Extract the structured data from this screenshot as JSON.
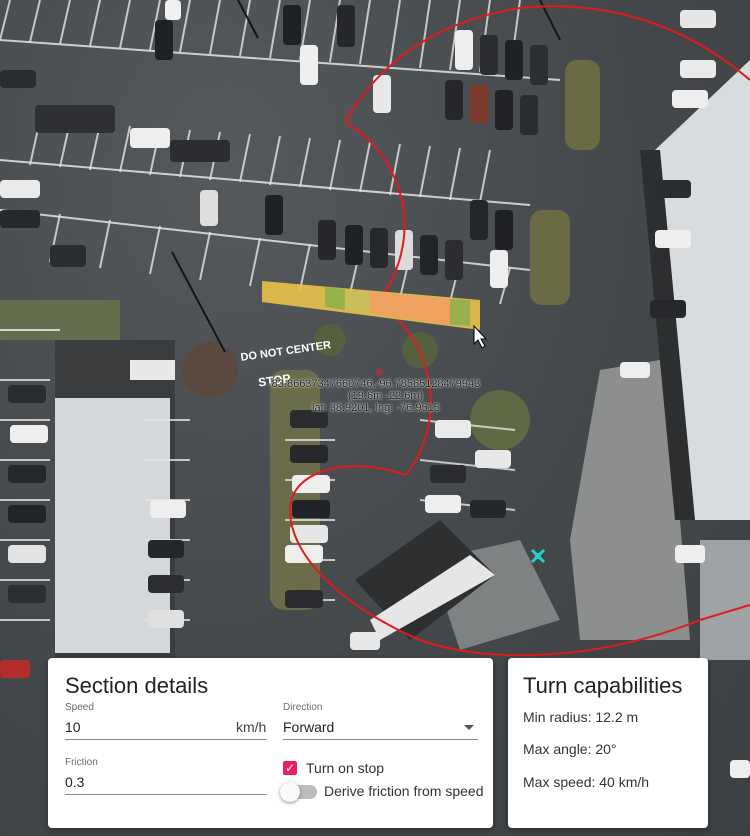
{
  "map": {
    "coordinate_label": {
      "line1": "-83.86637347660746,-96.78565128479943",
      "line2": "(19.6m -22.6m)",
      "line3": "lat: 38.9201, lng: -76.9515"
    },
    "road_text": {
      "line1": "DO NOT CENTER",
      "line2": "STOP"
    },
    "colors": {
      "turn_circle": "#e01b1b",
      "section_yellow": "#e8c24a",
      "section_orange": "#f0a060",
      "section_green": "#8fb04e",
      "marker": "#24d0c8"
    }
  },
  "section_details": {
    "title": "Section details",
    "speed": {
      "label": "Speed",
      "value": "10",
      "unit": "km/h"
    },
    "direction": {
      "label": "Direction",
      "value": "Forward"
    },
    "friction": {
      "label": "Friction",
      "value": "0.3"
    },
    "turn_on_stop": {
      "label": "Turn on stop",
      "checked": true
    },
    "derive_friction": {
      "label": "Derive friction from speed",
      "on": false
    }
  },
  "turn_capabilities": {
    "title": "Turn capabilities",
    "min_radius": "Min radius: 12.2 m",
    "max_angle": "Max angle: 20°",
    "max_speed": "Max speed: 40 km/h"
  }
}
